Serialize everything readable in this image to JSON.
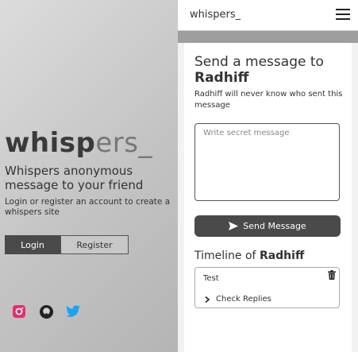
{
  "hero": {
    "brand_main": "whisp",
    "brand_tail": "ers_",
    "tagline": "Whispers anonymous message to your friend",
    "hint": "Login or register an account to create a whispers site",
    "login_label": "Login",
    "register_label": "Register"
  },
  "socials": [
    "instagram-icon",
    "github-icon",
    "twitter-icon"
  ],
  "topbar": {
    "title": "whispers_"
  },
  "card": {
    "heading": "Send a message to",
    "recipient": "Radhiff",
    "note": "Radhiff will never know who sent this message",
    "placeholder": "Write secret message",
    "send_label": "Send Message",
    "timeline_label": "Timeline of",
    "timeline_name": "Radhiff"
  },
  "timeline": [
    {
      "text": "Test",
      "replies_label": "Check Replies"
    }
  ],
  "colors": {
    "dark": "#4a4a4a",
    "instagram": "#e1306c",
    "twitter": "#1da1f2"
  }
}
